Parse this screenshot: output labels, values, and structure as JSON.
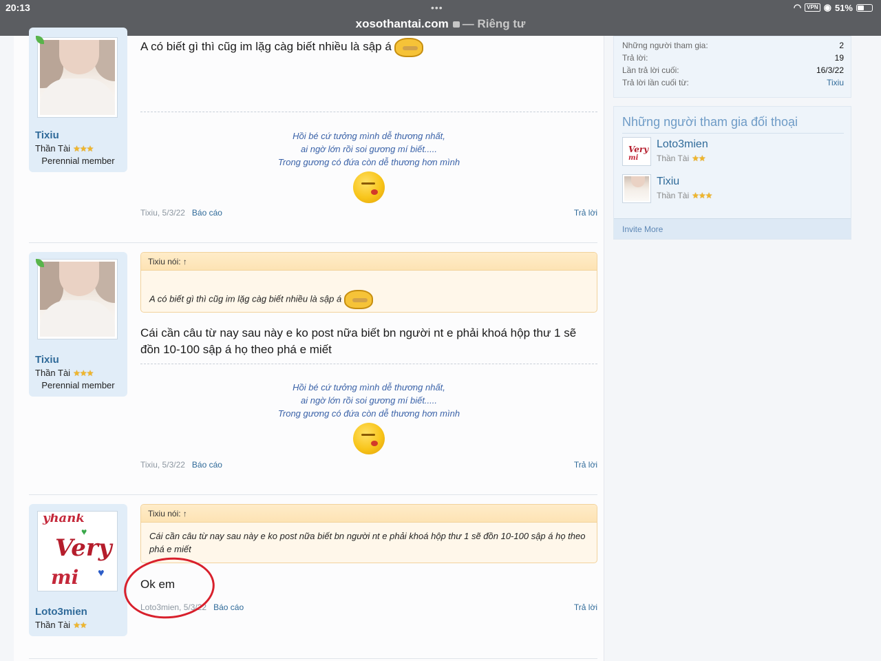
{
  "status_bar": {
    "time": "20:13",
    "domain": "xosothantai.com",
    "private_label": "— Riêng tư",
    "vpn": "VPN",
    "battery": "51%"
  },
  "posts": [
    {
      "user": {
        "name": "Tixiu",
        "title": "Thần Tài",
        "rank": "Perennial member"
      },
      "message": "A có biết gì thì cũg im lặg càg biết nhiều là sập á",
      "signature": [
        "Hồi bé cứ tưởng mình dễ thương nhất,",
        "ai ngờ lớn rồi soi gương mí biết.....",
        "Trong gương có đứa còn dễ thương hơn mình"
      ],
      "meta": "Tixiu, 5/3/22",
      "report": "Báo cáo",
      "reply": "Trả lời"
    },
    {
      "user": {
        "name": "Tixiu",
        "title": "Thần Tài",
        "rank": "Perennial member"
      },
      "quote_author": "Tixiu nói: ↑",
      "quote_text": "A có biết gì thì cũg im lặg càg biết nhiều là sập á",
      "message": "Cái cần câu từ nay sau này e ko post nữa biết bn người nt e phải khoá hộp thư 1 sẽ đồn 10-100 sập á họ theo phá e miết",
      "signature": [
        "Hồi bé cứ tưởng mình dễ thương nhất,",
        "ai ngờ lớn rồi soi gương mí biết.....",
        "Trong gương có đứa còn dễ thương hơn mình"
      ],
      "meta": "Tixiu, 5/3/22",
      "report": "Báo cáo",
      "reply": "Trả lời"
    },
    {
      "user": {
        "name": "Loto3mien",
        "title": "Thần Tài"
      },
      "quote_author": "Tixiu nói: ↑",
      "quote_text": "Cái cần câu từ nay sau này e ko post nữa biết bn người nt e phải khoá hộp thư 1 sẽ đồn 10-100 sập á họ theo phá e miết",
      "message": "Ok em",
      "meta": "Loto3mien, 5/3/22",
      "report": "Báo cáo",
      "reply": "Trả lời"
    }
  ],
  "sidebar": {
    "stats": [
      {
        "label": "Những người tham gia:",
        "value": "2"
      },
      {
        "label": "Trả lời:",
        "value": "19"
      },
      {
        "label": "Lần trả lời cuối:",
        "value": "16/3/22"
      },
      {
        "label": "Trả lời lần cuối từ:",
        "value": "Tixiu"
      }
    ],
    "participants_title": "Những người tham gia đối thoại",
    "participants": [
      {
        "name": "Loto3mien",
        "title": "Thần Tài"
      },
      {
        "name": "Tixiu",
        "title": "Thần Tài"
      }
    ],
    "invite": "Invite More"
  },
  "avatar_text": {
    "line1": "yhank",
    "line2": "Very",
    "line3": "mi"
  },
  "stars": {
    "three": "★★★",
    "two": "★★"
  },
  "colors": {
    "link": "#2f6a99",
    "quote_bg": "#fff7ea",
    "annotation": "#d8202c"
  }
}
